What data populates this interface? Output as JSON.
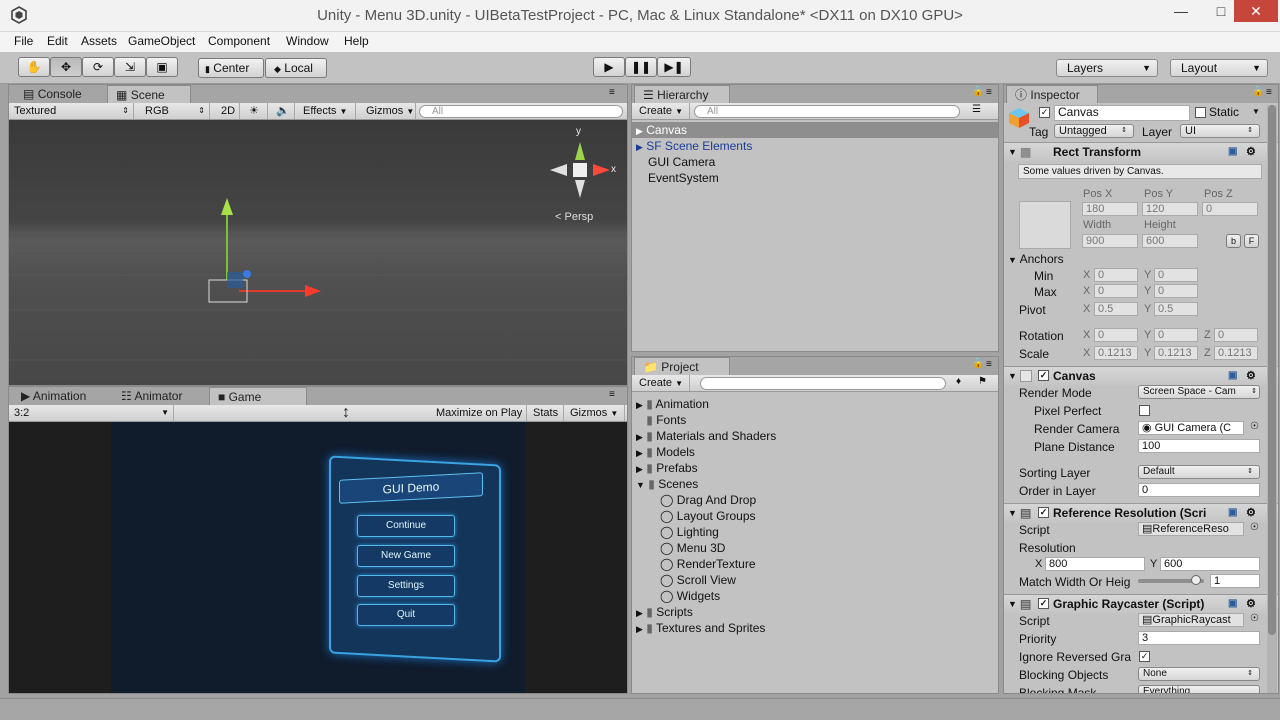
{
  "window": {
    "title": "Unity - Menu 3D.unity - UIBetaTestProject - PC, Mac & Linux Standalone* <DX11 on DX10 GPU>"
  },
  "menubar": {
    "items": [
      "File",
      "Edit",
      "Assets",
      "GameObject",
      "Component",
      "Window",
      "Help"
    ]
  },
  "toolbar": {
    "center": "Center",
    "local": "Local",
    "layers": "Layers",
    "layout": "Layout"
  },
  "scene_panel": {
    "tabs": [
      "Console",
      "Scene"
    ],
    "shading": "Textured",
    "render_mode": "RGB",
    "mode2d": "2D",
    "effects": "Effects",
    "gizmos": "Gizmos",
    "search_placeholder": "All",
    "persp": "Persp",
    "gizmo_y": "y",
    "gizmo_x": "x"
  },
  "game_panel": {
    "tabs": [
      "Animation",
      "Animator",
      "Game"
    ],
    "aspect": "3:2",
    "maximize": "Maximize on Play",
    "stats": "Stats",
    "gizmos": "Gizmos",
    "title": "GUI Demo",
    "buttons": [
      "Continue",
      "New Game",
      "Settings",
      "Quit"
    ]
  },
  "hierarchy": {
    "tab": "Hierarchy",
    "create": "Create",
    "search_placeholder": "All",
    "items": [
      "Canvas",
      "SF Scene Elements",
      "GUI Camera",
      "EventSystem"
    ]
  },
  "project": {
    "tab": "Project",
    "create": "Create",
    "folders": [
      "Animation",
      "Fonts",
      "Materials and Shaders",
      "Models",
      "Prefabs",
      "Scenes"
    ],
    "scenes": [
      "Drag And Drop",
      "Layout Groups",
      "Lighting",
      "Menu 3D",
      "RenderTexture",
      "Scroll View",
      "Widgets"
    ],
    "folders_after": [
      "Scripts",
      "Textures and Sprites"
    ]
  },
  "inspector": {
    "tab": "Inspector",
    "name": "Canvas",
    "static": "Static",
    "tag_label": "Tag",
    "tag": "Untagged",
    "layer_label": "Layer",
    "layer": "UI",
    "rect": {
      "title": "Rect Transform",
      "note": "Some values driven by Canvas.",
      "posx_l": "Pos X",
      "posy_l": "Pos Y",
      "posz_l": "Pos Z",
      "posx": "180",
      "posy": "120",
      "posz": "0",
      "width_l": "Width",
      "height_l": "Height",
      "width": "900",
      "height": "600",
      "b": "b",
      "f": "F",
      "anchors": "Anchors",
      "min": "Min",
      "max": "Max",
      "min_x": "0",
      "min_y": "0",
      "max_x": "0",
      "max_y": "0",
      "pivot": "Pivot",
      "pivot_x": "0.5",
      "pivot_y": "0.5",
      "rotation": "Rotation",
      "rot_x": "0",
      "rot_y": "0",
      "rot_z": "0",
      "scale": "Scale",
      "scale_x": "0.1213",
      "scale_y": "0.1213",
      "scale_z": "0.1213",
      "X": "X",
      "Y": "Y",
      "Z": "Z"
    },
    "canvas": {
      "title": "Canvas",
      "render_mode_l": "Render Mode",
      "render_mode": "Screen Space - Cam",
      "pixel_perfect": "Pixel Perfect",
      "render_camera_l": "Render Camera",
      "render_camera": "GUI Camera (C",
      "plane_distance_l": "Plane Distance",
      "plane_distance": "100",
      "sorting_layer_l": "Sorting Layer",
      "sorting_layer": "Default",
      "order_l": "Order in Layer",
      "order": "0"
    },
    "refres": {
      "title": "Reference Resolution (Scri",
      "script_l": "Script",
      "script": "ReferenceReso",
      "resolution_l": "Resolution",
      "res_x": "800",
      "res_y": "600",
      "match_l": "Match Width Or Heig",
      "match": "1",
      "match_fraction": 0.88
    },
    "raycaster": {
      "title": "Graphic Raycaster (Script)",
      "script_l": "Script",
      "script": "GraphicRaycast",
      "priority_l": "Priority",
      "priority": "3",
      "ignore_l": "Ignore Reversed Gra",
      "blocking_l": "Blocking Objects",
      "blocking": "None",
      "mask_l": "Blocking Mask",
      "mask": "Everything"
    }
  }
}
